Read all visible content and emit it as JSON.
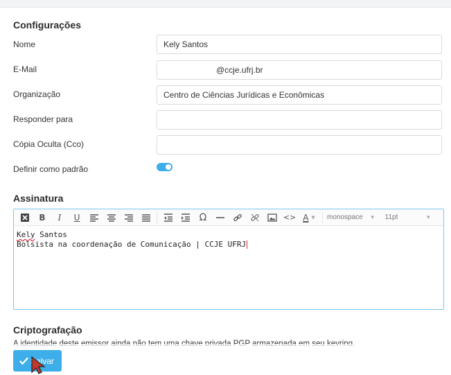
{
  "sections": {
    "settings_title": "Configurações",
    "signature_title": "Assinatura",
    "crypto_title": "Criptografação"
  },
  "form": {
    "name": {
      "label": "Nome",
      "value": "Kely Santos"
    },
    "email": {
      "label": "E-Mail",
      "value": "@ccje.ufrj.br"
    },
    "organization": {
      "label": "Organização",
      "value": "Centro de Ciências Jurídicas e Econômicas"
    },
    "reply_to": {
      "label": "Responder para",
      "value": ""
    },
    "bcc": {
      "label": "Cópia Oculta (Cco)",
      "value": ""
    },
    "default": {
      "label": "Definir como padrão",
      "checked": true
    }
  },
  "editor": {
    "font_family": "monospace",
    "font_size": "11pt",
    "lines": [
      {
        "first": "Kely",
        "rest": " Santos"
      },
      {
        "text": "Bolsista na coordenação de Comunicação | CCJE UFRJ"
      }
    ]
  },
  "crypto": {
    "description": "A identidade deste emissor ainda não tem uma chave privada PGP armazenada em seu keyring."
  },
  "actions": {
    "save_label": "Salvar"
  },
  "colors": {
    "accent": "#3daee9",
    "editor_border": "#79c7ef"
  }
}
